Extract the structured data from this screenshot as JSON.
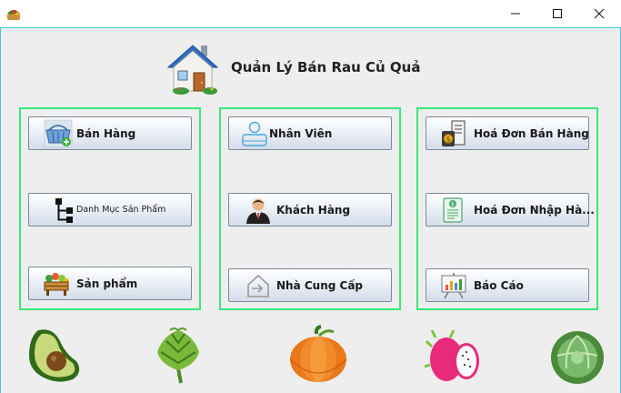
{
  "app": {
    "title": "Quản Lý Bán Rau Củ Quả"
  },
  "window_controls": {
    "minimize_icon": "minimize-icon",
    "maximize_icon": "maximize-icon",
    "close_icon": "close-icon"
  },
  "colors": {
    "panel_border": "#38e878",
    "client_border": "#44c8d8",
    "client_bg": "#eeeeee"
  },
  "buttons": {
    "ban_hang": "Bán Hàng",
    "danh_muc": "Danh Mục Sản Phẩm",
    "san_pham": "Sản phẩm",
    "nhan_vien": "Nhân Viên",
    "khach_hang": "Khách Hàng",
    "nha_cung_cap": "Nhà Cung Cấp",
    "hoa_don_ban": "Hoá Đơn Bán Hàng",
    "hoa_don_nhap": "Hoá Đơn Nhập Hà...",
    "bao_cao": "Báo Cáo"
  },
  "icons": {
    "ban_hang": "shopping-basket-icon",
    "danh_muc": "category-tree-icon",
    "san_pham": "vegetable-basket-icon",
    "nhan_vien": "employee-icon",
    "khach_hang": "customer-icon",
    "nha_cung_cap": "supplier-icon",
    "hoa_don_ban": "sales-invoice-icon",
    "hoa_don_nhap": "import-invoice-icon",
    "bao_cao": "report-chart-icon"
  },
  "decorations": [
    "avocado-icon",
    "artichoke-icon",
    "pumpkin-icon",
    "dragon-fruit-icon",
    "cabbage-icon"
  ]
}
